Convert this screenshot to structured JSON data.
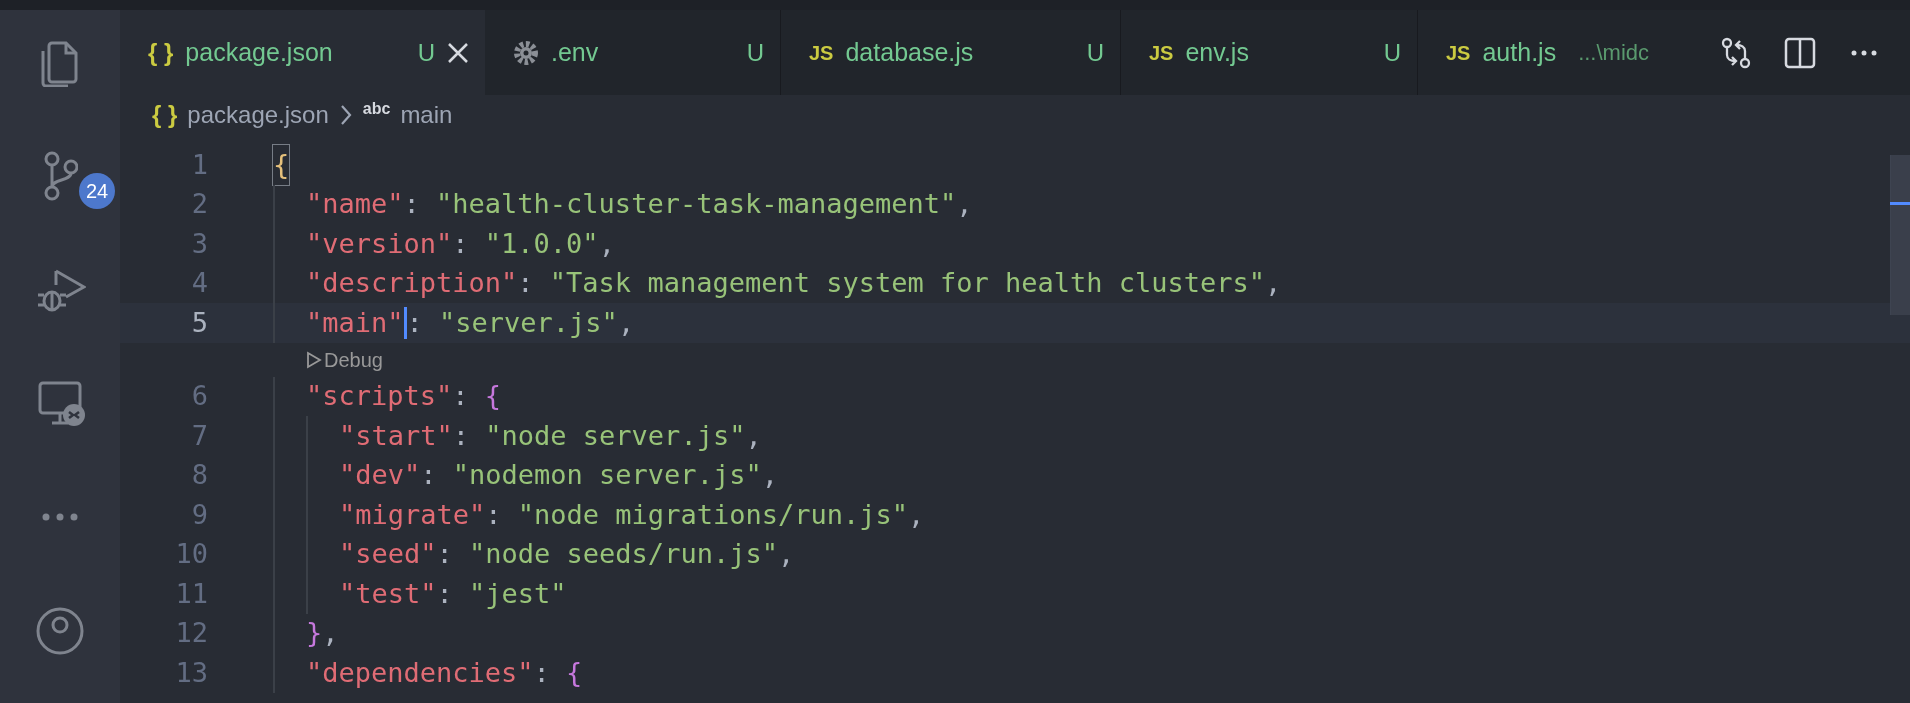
{
  "activity_bar": [
    {
      "kind": "files"
    },
    {
      "kind": "source-control",
      "badge": "24"
    },
    {
      "kind": "debug"
    },
    {
      "kind": "remote"
    },
    {
      "kind": "more"
    },
    {
      "kind": "account"
    }
  ],
  "tabs": [
    {
      "kind": "json",
      "icon_text": "{ }",
      "label": "package.json",
      "badge": "U",
      "selected": true
    },
    {
      "kind": "gear",
      "label": ".env",
      "badge": "U",
      "selected": false
    },
    {
      "kind": "js",
      "icon_text": "JS",
      "label": "database.js",
      "badge": "U",
      "selected": false
    },
    {
      "kind": "js",
      "icon_text": "JS",
      "label": "env.js",
      "badge": "U",
      "selected": false
    },
    {
      "kind": "js",
      "icon_text": "JS",
      "label": "auth.js",
      "description": "...\\midc",
      "selected": false
    }
  ],
  "editor_actions": [
    {
      "kind": "compare"
    },
    {
      "kind": "split"
    },
    {
      "kind": "more"
    }
  ],
  "breadcrumb": [
    {
      "icon_text": "{ }",
      "label": "package.json"
    },
    {
      "icon_text": "abc",
      "label": "main"
    }
  ],
  "code": [
    {
      "number": "1",
      "bracket_match": true,
      "tokens": [
        {
          "kind": "brace",
          "text": "{"
        }
      ],
      "children": [
        {
          "number": "2",
          "tokens": [
            {
              "kind": "key",
              "text": "\"name\""
            },
            {
              "kind": "punct",
              "text": ": "
            },
            {
              "kind": "string",
              "text": "\"health-cluster-task-management\""
            },
            {
              "kind": "punct",
              "text": ","
            }
          ]
        },
        {
          "number": "3",
          "tokens": [
            {
              "kind": "key",
              "text": "\"version\""
            },
            {
              "kind": "punct",
              "text": ": "
            },
            {
              "kind": "string",
              "text": "\"1.0.0\""
            },
            {
              "kind": "punct",
              "text": ","
            }
          ]
        },
        {
          "number": "4",
          "tokens": [
            {
              "kind": "key",
              "text": "\"description\""
            },
            {
              "kind": "punct",
              "text": ": "
            },
            {
              "kind": "string",
              "text": "\"Task management system for health clusters\""
            },
            {
              "kind": "punct",
              "text": ","
            }
          ]
        },
        {
          "number": "5",
          "selected": true,
          "codelens": "Debug",
          "tokens": [
            {
              "kind": "key",
              "text": "\"main\"",
              "cursor": true
            },
            {
              "kind": "punct",
              "text": ": "
            },
            {
              "kind": "string",
              "text": "\"server.js\""
            },
            {
              "kind": "punct",
              "text": ","
            }
          ]
        },
        {
          "number": "6",
          "tokens": [
            {
              "kind": "key",
              "text": "\"scripts\""
            },
            {
              "kind": "punct",
              "text": ": "
            },
            {
              "kind": "brace",
              "text": "{"
            }
          ],
          "children": [
            {
              "number": "7",
              "tokens": [
                {
                  "kind": "key",
                  "text": "\"start\""
                },
                {
                  "kind": "punct",
                  "text": ": "
                },
                {
                  "kind": "string",
                  "text": "\"node server.js\""
                },
                {
                  "kind": "punct",
                  "text": ","
                }
              ]
            },
            {
              "number": "8",
              "tokens": [
                {
                  "kind": "key",
                  "text": "\"dev\""
                },
                {
                  "kind": "punct",
                  "text": ": "
                },
                {
                  "kind": "string",
                  "text": "\"nodemon server.js\""
                },
                {
                  "kind": "punct",
                  "text": ","
                }
              ]
            },
            {
              "number": "9",
              "tokens": [
                {
                  "kind": "key",
                  "text": "\"migrate\""
                },
                {
                  "kind": "punct",
                  "text": ": "
                },
                {
                  "kind": "string",
                  "text": "\"node migrations/run.js\""
                },
                {
                  "kind": "punct",
                  "text": ","
                }
              ]
            },
            {
              "number": "10",
              "tokens": [
                {
                  "kind": "key",
                  "text": "\"seed\""
                },
                {
                  "kind": "punct",
                  "text": ": "
                },
                {
                  "kind": "string",
                  "text": "\"node seeds/run.js\""
                },
                {
                  "kind": "punct",
                  "text": ","
                }
              ]
            },
            {
              "number": "11",
              "tokens": [
                {
                  "kind": "key",
                  "text": "\"test\""
                },
                {
                  "kind": "punct",
                  "text": ": "
                },
                {
                  "kind": "string",
                  "text": "\"jest\""
                }
              ]
            }
          ]
        },
        {
          "number": "12",
          "tokens": [
            {
              "kind": "brace",
              "text": "}"
            },
            {
              "kind": "punct",
              "text": ","
            }
          ]
        },
        {
          "number": "13",
          "tokens": [
            {
              "kind": "key",
              "text": "\"dependencies\""
            },
            {
              "kind": "punct",
              "text": ": "
            },
            {
              "kind": "brace",
              "text": "{"
            }
          ]
        }
      ]
    }
  ]
}
